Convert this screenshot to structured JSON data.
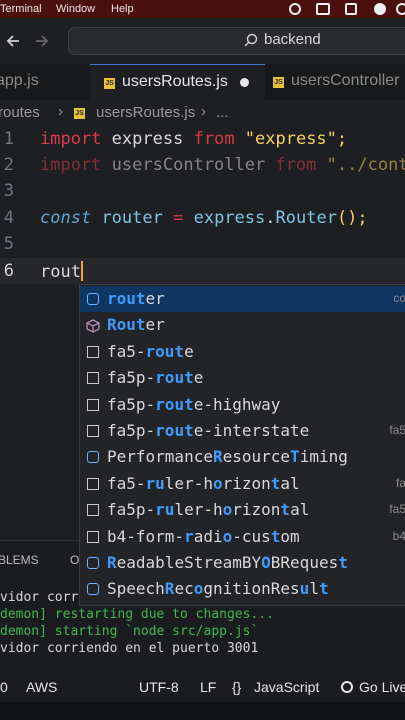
{
  "menubar": {
    "items": [
      "Terminal",
      "Window",
      "Help"
    ]
  },
  "titlebar": {
    "search_text": "backend"
  },
  "tabs": [
    {
      "label": "app.js",
      "active": false
    },
    {
      "label": "usersRoutes.js",
      "active": true
    },
    {
      "label": "usersController",
      "active": false
    }
  ],
  "breadcrumb": {
    "folder": "routes",
    "file": "usersRoutes.js",
    "more": "..."
  },
  "editor": {
    "lines": [
      {
        "num": "1",
        "kw1": "import",
        "name": "express",
        "kw2": "from",
        "str": "\"express\";"
      },
      {
        "num": "2",
        "kw1": "import",
        "name": "usersController",
        "kw2": "from",
        "str": "\"../cont"
      },
      {
        "num": "3"
      },
      {
        "num": "4",
        "kw": "const",
        "name": "router",
        "op": "=",
        "obj": "express",
        "dot": ".",
        "call": "Router",
        "tail": "();"
      },
      {
        "num": "5"
      },
      {
        "num": "6",
        "typed": "rout"
      }
    ]
  },
  "suggest": {
    "items": [
      {
        "pre": "",
        "hl": "rout",
        "post": "er",
        "detail": "co",
        "icon": "ref-icon",
        "selected": true
      },
      {
        "pre": "",
        "hl": "Rout",
        "post": "er",
        "detail": "",
        "icon": "module-icon"
      },
      {
        "pre": "fa5-",
        "hl": "rout",
        "post": "e",
        "detail": "",
        "icon": "snippet-icon"
      },
      {
        "pre": "fa5p-",
        "hl": "rout",
        "post": "e",
        "detail": "",
        "icon": "snippet-icon"
      },
      {
        "pre": "fa5p-",
        "hl": "rout",
        "post": "e-highway",
        "detail": "",
        "icon": "snippet-icon"
      },
      {
        "pre": "fa5p-",
        "hl": "rout",
        "post": "e-interstate",
        "detail": "fa5",
        "icon": "snippet-icon"
      },
      {
        "pre": "Performance",
        "hl": "R",
        "post": "esource",
        "hl2": "T",
        "post2": "iming",
        "detail": "",
        "icon": "ref-icon"
      },
      {
        "pre": "fa5-",
        "hl": "ru",
        "post": "ler-h",
        "hl2": "o",
        "post2": "rizon",
        "hl3": "t",
        "post3": "al",
        "detail": "fa",
        "icon": "snippet-icon"
      },
      {
        "pre": "fa5p-",
        "hl": "ru",
        "post": "ler-h",
        "hl2": "o",
        "post2": "rizon",
        "hl3": "t",
        "post3": "al",
        "detail": "fa5",
        "icon": "snippet-icon"
      },
      {
        "pre": "b4-form-",
        "hl": "r",
        "post": "adi",
        "hl2": "o",
        "post2": "-cus",
        "hl3": "t",
        "post3": "om",
        "detail": "b4",
        "icon": "snippet-icon"
      },
      {
        "pre": "",
        "hl": "R",
        "post": "eadableStreamBY",
        "hl2": "O",
        "post2": "BReques",
        "hl3": "t",
        "post3": "",
        "detail": "",
        "icon": "ref-icon"
      },
      {
        "pre": "Speech",
        "hl": "R",
        "post": "ec",
        "hl2": "o",
        "post2": "gnitionRes",
        "hl3": "u",
        "post3": "l",
        "hl4": "t",
        "post4": "",
        "detail": "",
        "icon": "ref-icon"
      }
    ]
  },
  "panel": {
    "tab_label": "BLEMS",
    "tab2_label": "O",
    "lines": [
      {
        "text": "vidor corr",
        "color": "#d8d8d8"
      },
      {
        "text": "demon] restarting due to changes...",
        "color": "#3fb950"
      },
      {
        "text": "demon] starting `node src/app.js`",
        "color": "#3fb950"
      },
      {
        "text": "vidor corriendo en el puerto 3001",
        "color": "#d8d8d8"
      }
    ]
  },
  "status": {
    "errors": "0",
    "aws": "AWS",
    "encoding": "UTF-8",
    "eol": "LF",
    "language": "JavaScript",
    "golive": "Go Live"
  },
  "colors": {
    "accent": "#3f9cff",
    "keyword": "#d73a49",
    "string": "#f7d060",
    "selection": "#0f3660"
  }
}
